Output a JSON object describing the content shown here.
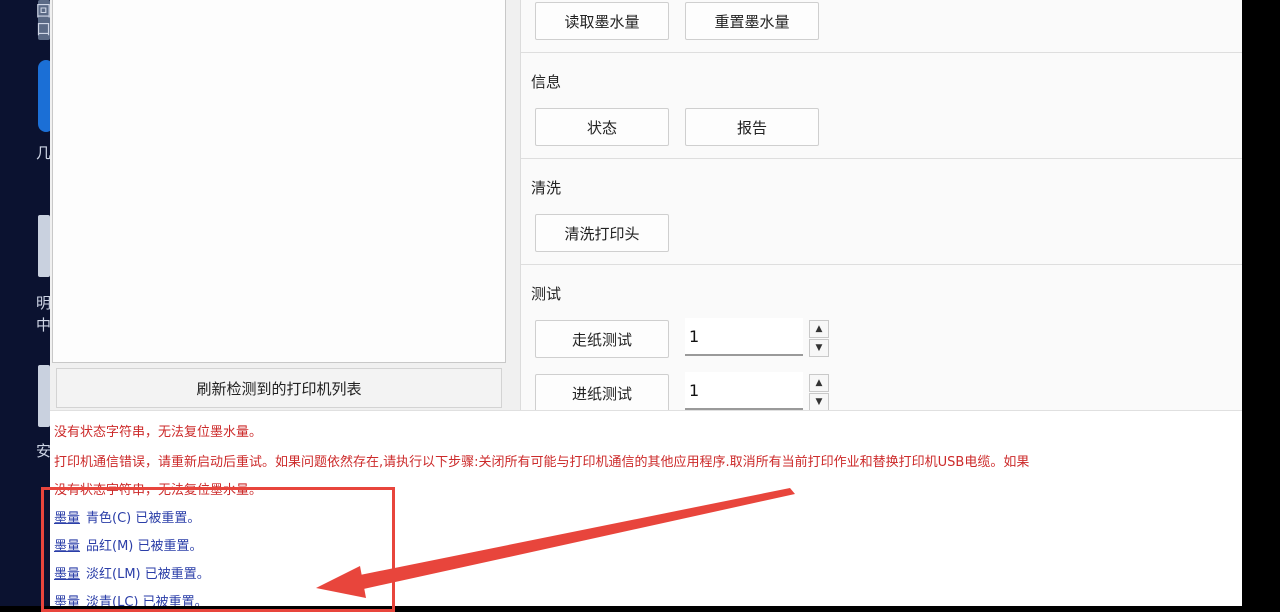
{
  "taskbar": {
    "chars": [
      "回",
      "口",
      "几",
      "明",
      "中",
      "安"
    ]
  },
  "left_panel": {
    "refresh_label": "刷新检测到的打印机列表"
  },
  "ink": {
    "read_label": "读取墨水量",
    "reset_label": "重置墨水量"
  },
  "info": {
    "title": "信息",
    "status_label": "状态",
    "report_label": "报告"
  },
  "clean": {
    "title": "清洗",
    "clean_head_label": "清洗打印头"
  },
  "test": {
    "title": "测试",
    "feed_test_label": "走纸测试",
    "feed_test_value": "1",
    "load_test_label": "进纸测试",
    "load_test_value": "1"
  },
  "log": {
    "lines": [
      {
        "type": "error",
        "text": "没有状态字符串，无法复位墨水量。"
      },
      {
        "type": "error",
        "text": "打印机通信错误，请重新启动后重试。如果问题依然存在,请执行以下步骤:关闭所有可能与打印机通信的其他应用程序.取消所有当前打印作业和替换打印机USB电缆。如果"
      },
      {
        "type": "error",
        "text": "没有状态字符串，无法复位墨水量。"
      },
      {
        "type": "ok",
        "tag": "墨量",
        "text": "青色(C) 已被重置。"
      },
      {
        "type": "ok",
        "tag": "墨量",
        "text": "品红(M) 已被重置。"
      },
      {
        "type": "ok",
        "tag": "墨量",
        "text": "淡红(LM) 已被重置。"
      },
      {
        "type": "ok",
        "tag": "墨量",
        "text": "淡青(LC) 已被重置。"
      }
    ]
  },
  "colors": {
    "error": "#cc2a2a",
    "ok": "#2b3ea8",
    "annotation": "#e8453c"
  }
}
